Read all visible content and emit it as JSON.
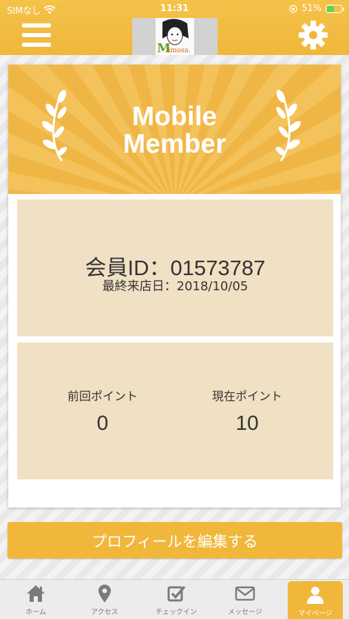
{
  "status_bar": {
    "carrier": "SIMなし",
    "time": "11:31",
    "battery_percent": "51%",
    "battery_level": 0.51,
    "icons": [
      "wifi-icon",
      "orientation-lock-icon",
      "battery-icon"
    ]
  },
  "header": {
    "menu_icon": "hamburger-menu-icon",
    "settings_icon": "gear-icon",
    "logo_text": "Mimosa"
  },
  "card": {
    "banner_title_line1": "Mobile",
    "banner_title_line2": "Member",
    "member_id": "会員ID：01573787",
    "last_visit": "最終来店日：2018/10/05",
    "previous_points_label": "前回ポイント",
    "previous_points_value": "0",
    "current_points_label": "現在ポイント",
    "current_points_value": "10"
  },
  "edit_profile_button": "プロフィールを編集する",
  "tabs": [
    {
      "label": "ホーム",
      "icon": "home-icon",
      "active": false
    },
    {
      "label": "アクセス",
      "icon": "map-pin-icon",
      "active": false
    },
    {
      "label": "チェックイン",
      "icon": "checkin-icon",
      "active": false
    },
    {
      "label": "メッセージ",
      "icon": "envelope-icon",
      "active": false
    },
    {
      "label": "マイページ",
      "icon": "user-icon",
      "active": true
    }
  ],
  "colors": {
    "accent": "#f0b73b",
    "panel": "#f0e0c4",
    "text": "#333333"
  }
}
